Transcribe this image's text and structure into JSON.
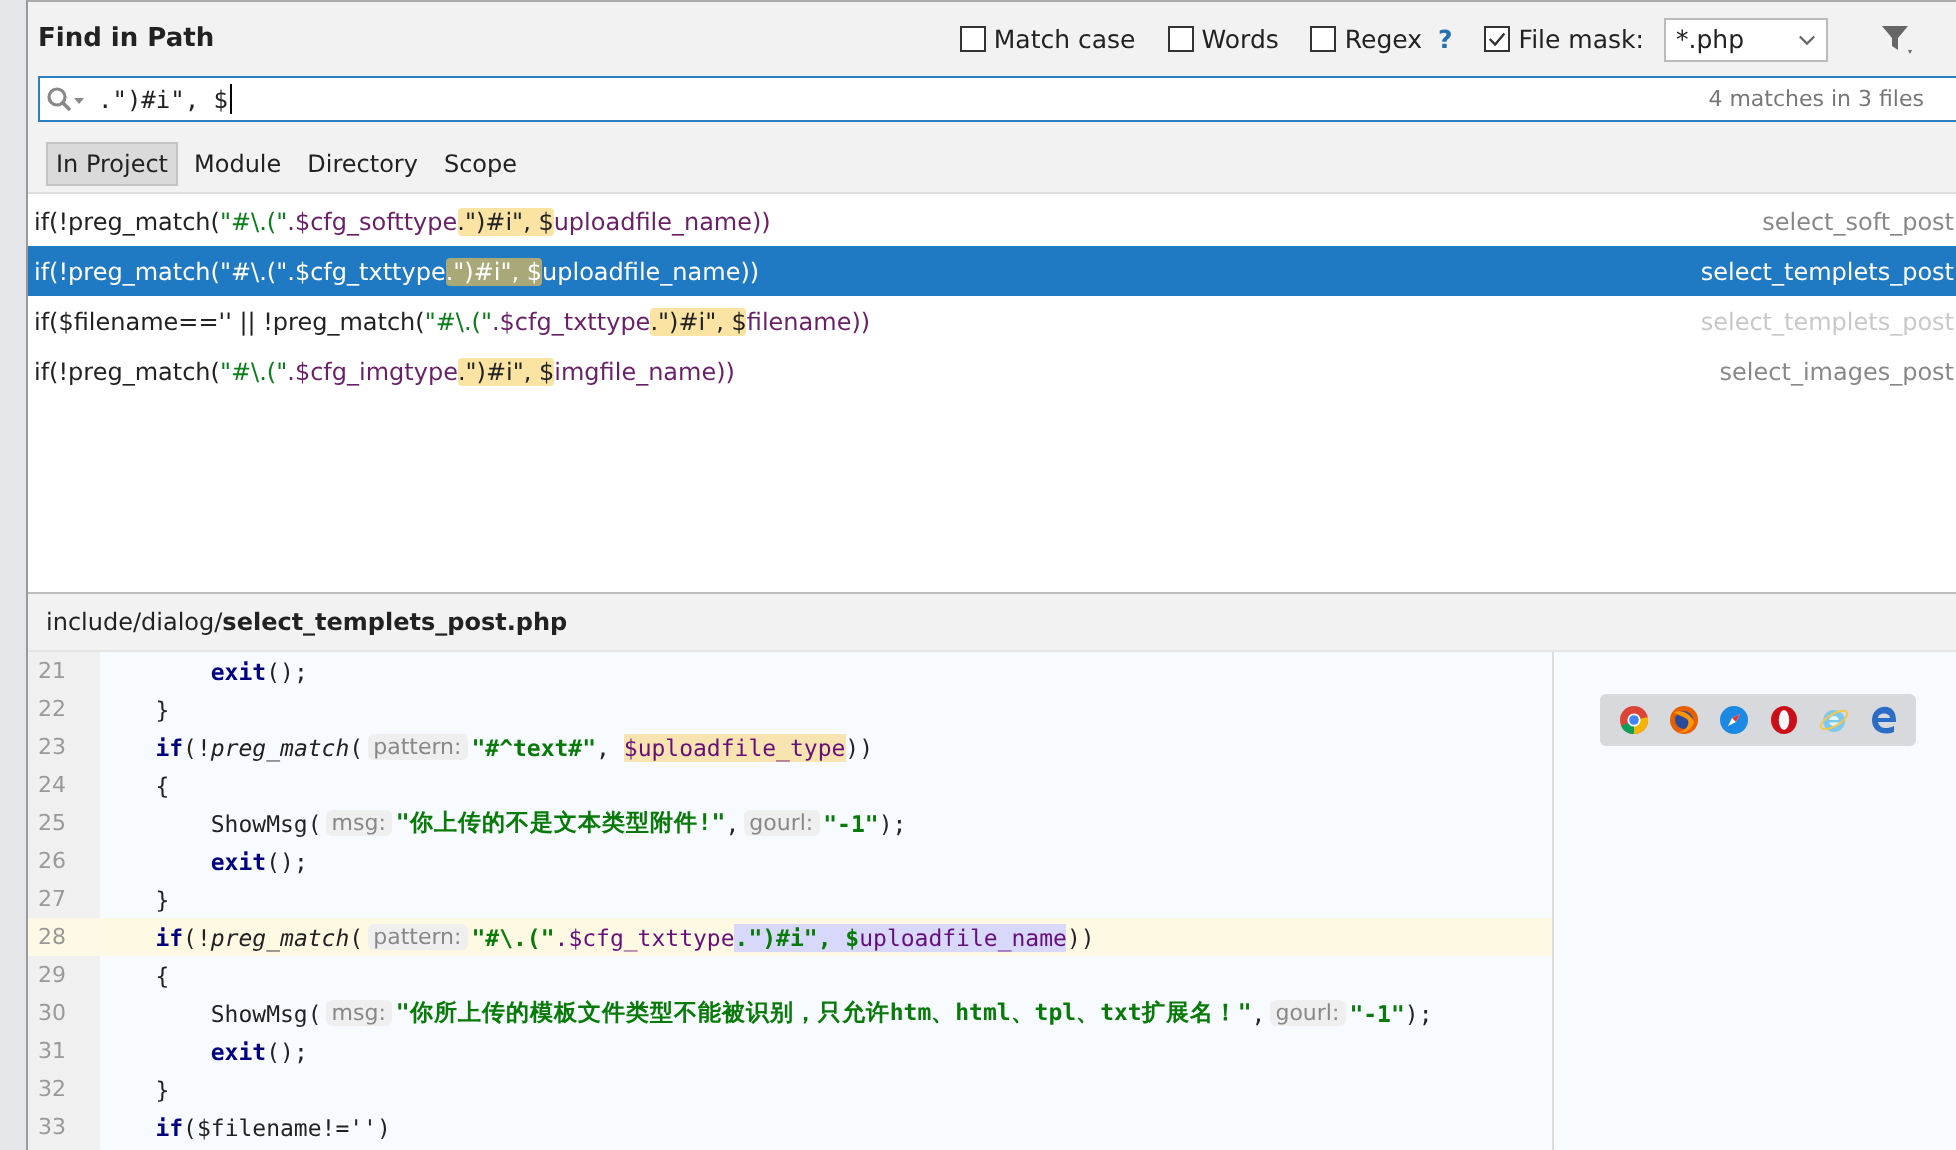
{
  "dialog": {
    "title": "Find in Path"
  },
  "options": [
    {
      "label": "Match case",
      "checked": false
    },
    {
      "label": "Words",
      "checked": false
    },
    {
      "label": "Regex",
      "checked": false,
      "help": "?"
    },
    {
      "label": "File mask:",
      "checked": true
    }
  ],
  "file_mask": {
    "value": "*.php"
  },
  "search": {
    "value": ".\")#i\", $",
    "summary": "4 matches in 3 files"
  },
  "scopes": [
    {
      "label": "In Project",
      "selected": true
    },
    {
      "label": "Module",
      "selected": false
    },
    {
      "label": "Directory",
      "selected": false
    },
    {
      "label": "Scope",
      "selected": false
    }
  ],
  "results": [
    {
      "selected": false,
      "dimmed": false,
      "file": "select_soft_post",
      "segments": [
        {
          "text": "if(!preg_match(",
          "kind": "plain",
          "match": false
        },
        {
          "text": "\"#\\.(\"",
          "kind": "str",
          "match": false
        },
        {
          "text": ".$cfg_softtype",
          "kind": "var",
          "match": false
        },
        {
          "text": ".\")#i\", $",
          "kind": "plain",
          "match": true
        },
        {
          "text": "uploadfile_name))",
          "kind": "var",
          "match": false
        }
      ]
    },
    {
      "selected": true,
      "dimmed": false,
      "file": "select_templets_post",
      "segments": [
        {
          "text": "if(!preg_match(",
          "kind": "plain",
          "match": false
        },
        {
          "text": "\"#\\.(\"",
          "kind": "str",
          "match": false
        },
        {
          "text": ".$cfg_txttype",
          "kind": "var",
          "match": false
        },
        {
          "text": ".\")#i\", $",
          "kind": "plain",
          "match": true
        },
        {
          "text": "uploadfile_name))",
          "kind": "var",
          "match": false
        }
      ]
    },
    {
      "selected": false,
      "dimmed": true,
      "file": "select_templets_post",
      "segments": [
        {
          "text": "if($filename=='' || !preg_match(",
          "kind": "plain",
          "match": false
        },
        {
          "text": "\"#\\.(\"",
          "kind": "str",
          "match": false
        },
        {
          "text": ".$cfg_txttype",
          "kind": "var",
          "match": false
        },
        {
          "text": ".\")#i\", $",
          "kind": "plain",
          "match": true
        },
        {
          "text": "filename))",
          "kind": "var",
          "match": false
        }
      ]
    },
    {
      "selected": false,
      "dimmed": false,
      "file": "select_images_post",
      "segments": [
        {
          "text": "if(!preg_match(",
          "kind": "plain",
          "match": false
        },
        {
          "text": "\"#\\.(\"",
          "kind": "str",
          "match": false
        },
        {
          "text": ".$cfg_imgtype",
          "kind": "var",
          "match": false
        },
        {
          "text": ".\")#i\", $",
          "kind": "plain",
          "match": true
        },
        {
          "text": "imgfile_name))",
          "kind": "var",
          "match": false
        }
      ]
    }
  ],
  "preview": {
    "path": "include/dialog/",
    "file": "select_templets_post.php",
    "lines": [
      {
        "number": "21",
        "current": false,
        "tokens": [
          {
            "text": "        exit",
            "kind": "kw"
          },
          {
            "text": "();",
            "kind": "plain"
          }
        ]
      },
      {
        "number": "22",
        "current": false,
        "tokens": [
          {
            "text": "    }",
            "kind": "plain"
          }
        ]
      },
      {
        "number": "23",
        "current": false,
        "tokens": [
          {
            "text": "    if",
            "kind": "kw"
          },
          {
            "text": "(!",
            "kind": "plain"
          },
          {
            "text": "preg_match",
            "kind": "fn"
          },
          {
            "text": "(",
            "kind": "plain"
          },
          {
            "text": "pattern:",
            "kind": "hint"
          },
          {
            "text": "\"#^text#\"",
            "kind": "str"
          },
          {
            "text": ", ",
            "kind": "plain"
          },
          {
            "text": "$uploadfile_type",
            "kind": "var",
            "highlighted": true
          },
          {
            "text": "))",
            "kind": "plain"
          }
        ]
      },
      {
        "number": "24",
        "current": false,
        "tokens": [
          {
            "text": "    {",
            "kind": "plain"
          }
        ]
      },
      {
        "number": "25",
        "current": false,
        "tokens": [
          {
            "text": "        ShowMsg(",
            "kind": "plain"
          },
          {
            "text": "msg:",
            "kind": "hint"
          },
          {
            "text": "\"你上传的不是文本类型附件!\"",
            "kind": "str"
          },
          {
            "text": ",",
            "kind": "plain"
          },
          {
            "text": "gourl:",
            "kind": "hint"
          },
          {
            "text": "\"-1\"",
            "kind": "str"
          },
          {
            "text": ");",
            "kind": "plain"
          }
        ]
      },
      {
        "number": "26",
        "current": false,
        "tokens": [
          {
            "text": "        exit",
            "kind": "kw"
          },
          {
            "text": "();",
            "kind": "plain"
          }
        ]
      },
      {
        "number": "27",
        "current": false,
        "tokens": [
          {
            "text": "    }",
            "kind": "plain"
          }
        ]
      },
      {
        "number": "28",
        "current": true,
        "tokens": [
          {
            "text": "    if",
            "kind": "kw"
          },
          {
            "text": "(!",
            "kind": "plain"
          },
          {
            "text": "preg_match",
            "kind": "fn"
          },
          {
            "text": "(",
            "kind": "plain"
          },
          {
            "text": "pattern:",
            "kind": "hint"
          },
          {
            "text": "\"#\\.(\"",
            "kind": "str"
          },
          {
            "text": ".$cfg_txttype",
            "kind": "var"
          },
          {
            "text": ".\")#i\", $",
            "kind": "str",
            "selected": true
          },
          {
            "text": "uploadfile_name",
            "kind": "var",
            "selected": true
          },
          {
            "text": "))",
            "kind": "plain"
          }
        ]
      },
      {
        "number": "29",
        "current": false,
        "tokens": [
          {
            "text": "    {",
            "kind": "plain"
          }
        ]
      },
      {
        "number": "30",
        "current": false,
        "tokens": [
          {
            "text": "        ShowMsg(",
            "kind": "plain"
          },
          {
            "text": "msg:",
            "kind": "hint"
          },
          {
            "text": "\"你所上传的模板文件类型不能被识别，只允许htm、html、tpl、txt扩展名！\"",
            "kind": "str"
          },
          {
            "text": ",",
            "kind": "plain"
          },
          {
            "text": "gourl:",
            "kind": "hint"
          },
          {
            "text": "\"-1\"",
            "kind": "str"
          },
          {
            "text": ");",
            "kind": "plain"
          }
        ]
      },
      {
        "number": "31",
        "current": false,
        "tokens": [
          {
            "text": "        exit",
            "kind": "kw"
          },
          {
            "text": "();",
            "kind": "plain"
          }
        ]
      },
      {
        "number": "32",
        "current": false,
        "tokens": [
          {
            "text": "    }",
            "kind": "plain"
          }
        ]
      },
      {
        "number": "33",
        "current": false,
        "tokens": [
          {
            "text": "    if",
            "kind": "kw"
          },
          {
            "text": "($filename!='')",
            "kind": "plain"
          }
        ]
      }
    ]
  }
}
